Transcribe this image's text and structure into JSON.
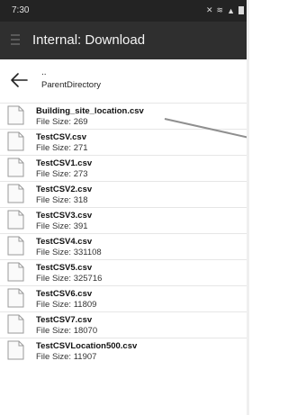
{
  "status_bar": {
    "time": "7:30"
  },
  "toolbar": {
    "title": "Internal: Download"
  },
  "parent": {
    "dots": "..",
    "label": "ParentDirectory"
  },
  "files": [
    {
      "name": "Building_site_location.csv",
      "size_label": "File Size: 269"
    },
    {
      "name": "TestCSV.csv",
      "size_label": "File Size: 271"
    },
    {
      "name": "TestCSV1.csv",
      "size_label": "File Size: 273"
    },
    {
      "name": "TestCSV2.csv",
      "size_label": "File Size: 318"
    },
    {
      "name": "TestCSV3.csv",
      "size_label": "File Size: 391"
    },
    {
      "name": "TestCSV4.csv",
      "size_label": "File Size: 331108"
    },
    {
      "name": "TestCSV5.csv",
      "size_label": "File Size: 325716"
    },
    {
      "name": "TestCSV6.csv",
      "size_label": "File Size: 11809"
    },
    {
      "name": "TestCSV7.csv",
      "size_label": "File Size: 18070"
    },
    {
      "name": "TestCSVLocation500.csv",
      "size_label": "File Size: 11907"
    }
  ],
  "colors": {
    "toolbar": "#2f2f2f",
    "status_bar": "#232323",
    "pointer": "#8f8f8f"
  }
}
